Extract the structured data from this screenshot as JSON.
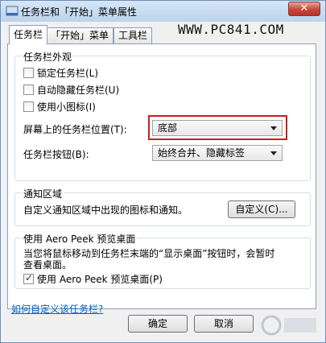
{
  "window": {
    "title": "任务栏和「开始」菜单属性",
    "close_label": "✕"
  },
  "tabs": [
    {
      "label": "任务栏",
      "active": true
    },
    {
      "label": "「开始」菜单",
      "active": false
    },
    {
      "label": "工具栏",
      "active": false
    }
  ],
  "watermark": "WWW.PC841.COM",
  "appearance": {
    "group_label": "任务栏外观",
    "lock_taskbar": {
      "label": "锁定任务栏(L)",
      "checked": false
    },
    "auto_hide": {
      "label": "自动隐藏任务栏(U)",
      "checked": false
    },
    "small_icons": {
      "label": "使用小图标(I)",
      "checked": false
    },
    "position_label": "屏幕上的任务栏位置(T):",
    "position_value": "底部",
    "buttons_label": "任务栏按钮(B):",
    "buttons_value": "始终合并、隐藏标签"
  },
  "notification": {
    "group_label": "通知区域",
    "description": "自定义通知区域中出现的图标和通知。",
    "customize_button": "自定义(C)..."
  },
  "aero_peek": {
    "group_label": "使用 Aero Peek 预览桌面",
    "description_line1": "当您将鼠标移动到任务栏末端的“显示桌面”按钮时，会暂时",
    "description_line2": "查看桌面。",
    "checkbox": {
      "label": "使用 Aero Peek 预览桌面(P)",
      "checked": true
    }
  },
  "help_link": "如何自定义该任务栏?",
  "footer": {
    "ok_label": "确定",
    "cancel_label": "取消"
  }
}
